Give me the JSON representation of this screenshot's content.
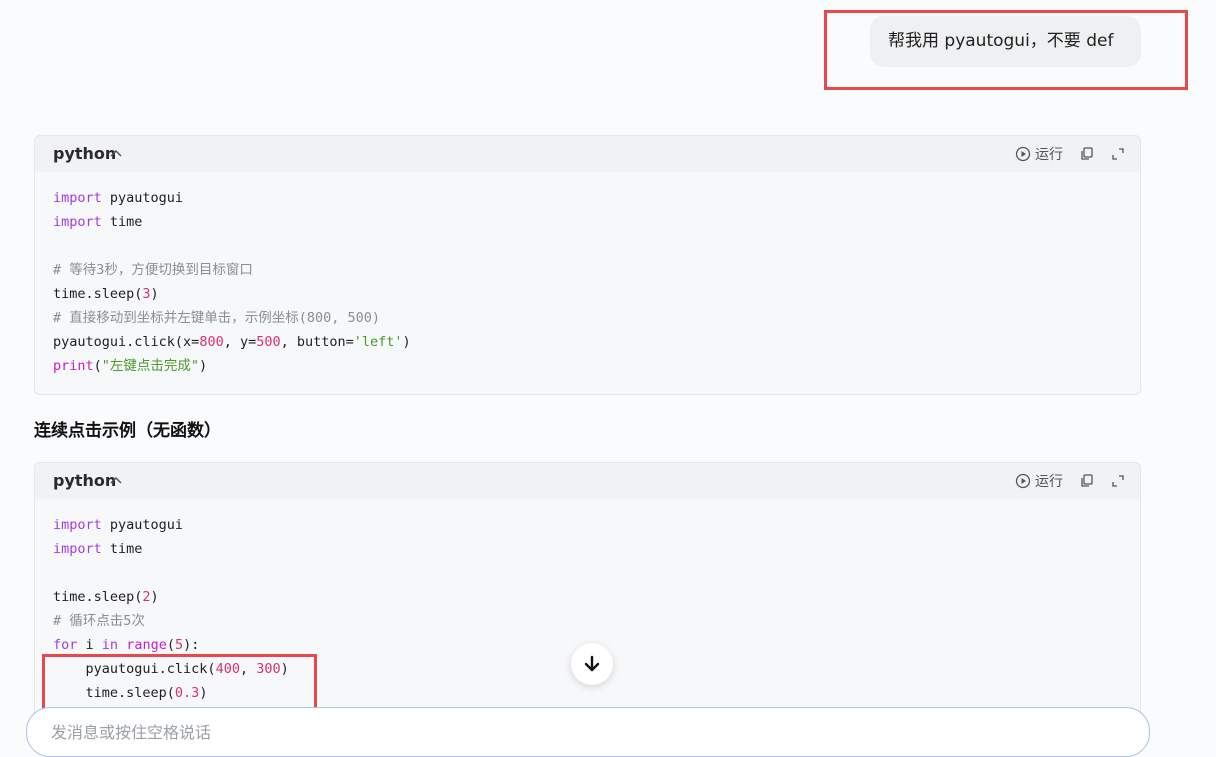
{
  "user_message": "帮我用 pyautogui，不要 def",
  "code_blocks": [
    {
      "language": "python",
      "run_label": "运行",
      "lines": [
        [
          {
            "t": "import",
            "c": "kw"
          },
          {
            "t": " pyautogui",
            "c": ""
          }
        ],
        [
          {
            "t": "import",
            "c": "kw"
          },
          {
            "t": " time",
            "c": ""
          }
        ],
        [],
        [
          {
            "t": "# 等待3秒，方便切换到目标窗口",
            "c": "cm"
          }
        ],
        [
          {
            "t": "time.sleep(",
            "c": ""
          },
          {
            "t": "3",
            "c": "num"
          },
          {
            "t": ")",
            "c": ""
          }
        ],
        [
          {
            "t": "# 直接移动到坐标并左键单击，示例坐标(800, 500)",
            "c": "cm"
          }
        ],
        [
          {
            "t": "pyautogui.click(x=",
            "c": ""
          },
          {
            "t": "800",
            "c": "num"
          },
          {
            "t": ", y=",
            "c": ""
          },
          {
            "t": "500",
            "c": "num"
          },
          {
            "t": ", button=",
            "c": ""
          },
          {
            "t": "'left'",
            "c": "str"
          },
          {
            "t": ")",
            "c": ""
          }
        ],
        [
          {
            "t": "print",
            "c": "bi"
          },
          {
            "t": "(",
            "c": ""
          },
          {
            "t": "\"左键点击完成\"",
            "c": "str"
          },
          {
            "t": ")",
            "c": ""
          }
        ]
      ]
    },
    {
      "language": "python",
      "run_label": "运行",
      "lines": [
        [
          {
            "t": "import",
            "c": "kw"
          },
          {
            "t": " pyautogui",
            "c": ""
          }
        ],
        [
          {
            "t": "import",
            "c": "kw"
          },
          {
            "t": " time",
            "c": ""
          }
        ],
        [],
        [
          {
            "t": "time.sleep(",
            "c": ""
          },
          {
            "t": "2",
            "c": "num"
          },
          {
            "t": ")",
            "c": ""
          }
        ],
        [
          {
            "t": "# 循环点击5次",
            "c": "cm"
          }
        ],
        [
          {
            "t": "for",
            "c": "kw"
          },
          {
            "t": " i ",
            "c": ""
          },
          {
            "t": "in",
            "c": "kw"
          },
          {
            "t": " ",
            "c": ""
          },
          {
            "t": "range",
            "c": "bi"
          },
          {
            "t": "(",
            "c": ""
          },
          {
            "t": "5",
            "c": "num"
          },
          {
            "t": "):",
            "c": ""
          }
        ],
        [
          {
            "t": "    pyautogui.click(",
            "c": ""
          },
          {
            "t": "400",
            "c": "num"
          },
          {
            "t": ", ",
            "c": ""
          },
          {
            "t": "300",
            "c": "num"
          },
          {
            "t": ")",
            "c": ""
          }
        ],
        [
          {
            "t": "    time.sleep(",
            "c": ""
          },
          {
            "t": "0.3",
            "c": "num"
          },
          {
            "t": ")",
            "c": ""
          }
        ]
      ]
    }
  ],
  "section_heading": "连续点击示例（无函数）",
  "input": {
    "placeholder": "发消息或按住空格说话"
  },
  "colors": {
    "highlight": "#e8474b",
    "keyword": "#a23de0",
    "number": "#d6336c",
    "string": "#4a9a2a",
    "comment": "#8a8d92"
  },
  "icons": [
    "chevron-up-icon",
    "play-circle-icon",
    "copy-icon",
    "expand-icon",
    "arrow-down-icon"
  ]
}
